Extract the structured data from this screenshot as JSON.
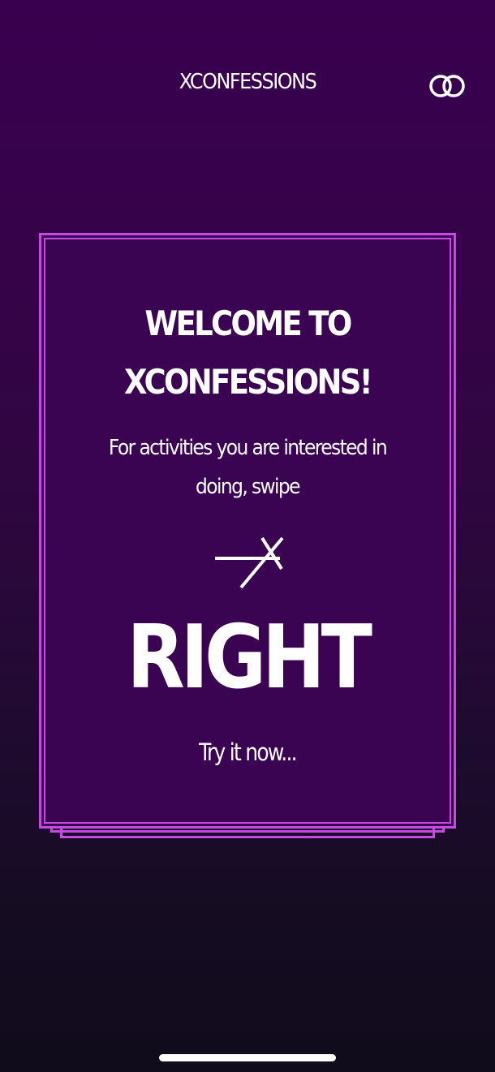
{
  "header": {
    "title": "XCONFESSIONS",
    "right_icon": "rings-icon"
  },
  "card": {
    "title_line_1": "WELCOME TO",
    "title_line_2": "XCONFESSIONS!",
    "instruction_line_1": "For activities you are interested in",
    "instruction_line_2": "doing, swipe",
    "arrow_icon": "arrow-right-icon",
    "direction": "RIGHT",
    "prompt": "Try it now..."
  },
  "colors": {
    "background_top": "#39004f",
    "background_bottom": "#100c1b",
    "card_fill": "#3a0453",
    "card_border": "#c649e2",
    "text": "#ffffff"
  }
}
